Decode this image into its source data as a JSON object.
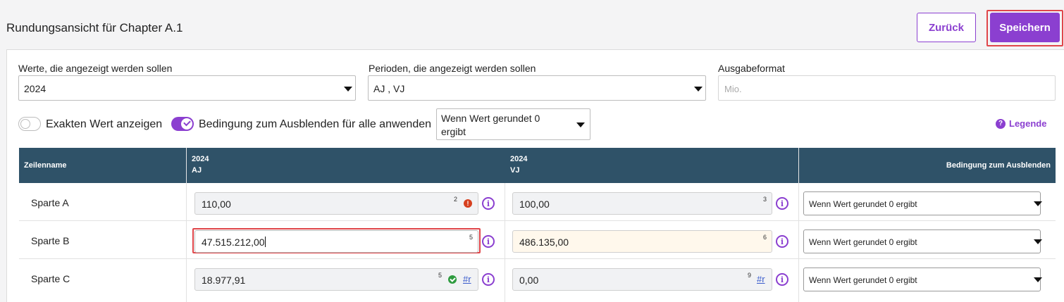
{
  "header": {
    "title": "Rundungsansicht für Chapter A.1",
    "back_label": "Zurück",
    "save_label": "Speichern"
  },
  "filters": {
    "values_label": "Werte, die angezeigt werden sollen",
    "values_selected": "2024",
    "periods_label": "Perioden, die angezeigt werden sollen",
    "periods_selected": "AJ , VJ",
    "format_label": "Ausgabeformat",
    "format_placeholder": "Mio."
  },
  "options": {
    "exact_value_label": "Exakten Wert anzeigen",
    "exact_value_on": false,
    "hide_condition_all_label": "Bedingung zum Ausblenden für alle anwenden",
    "hide_condition_all_on": true,
    "hide_condition_selected": "Wenn Wert gerundet 0 ergibt",
    "legend_label": "Legende"
  },
  "table": {
    "col_row_name": "Zeilenname",
    "col1_year": "2024",
    "col1_period": "AJ",
    "col2_year": "2024",
    "col2_period": "VJ",
    "col_condition": "Bedingung zum Ausblenden",
    "rows": [
      {
        "name": "Sparte A",
        "aj_value": "110,00",
        "aj_sup": "2",
        "aj_status": "error",
        "vj_value": "100,00",
        "vj_sup": "3",
        "condition": "Wenn Wert gerundet 0 ergibt"
      },
      {
        "name": "Sparte B",
        "aj_value": "47.515.212,00",
        "aj_sup": "5",
        "aj_status": "editing",
        "vj_value": "486.135,00",
        "vj_sup": "6",
        "condition": "Wenn Wert gerundet 0 ergibt"
      },
      {
        "name": "Sparte C",
        "aj_value": "18.977,91",
        "aj_sup": "5",
        "aj_status": "ok",
        "aj_ref": "#r",
        "vj_value": "0,00",
        "vj_sup": "9",
        "vj_ref": "#r",
        "condition": "Wenn Wert gerundet 0 ergibt"
      }
    ]
  },
  "colors": {
    "accent": "#8b3fd0",
    "table_header": "#2f5268",
    "highlight_outline": "#e0464a",
    "error": "#d6401f",
    "ok": "#2e9b3f"
  }
}
